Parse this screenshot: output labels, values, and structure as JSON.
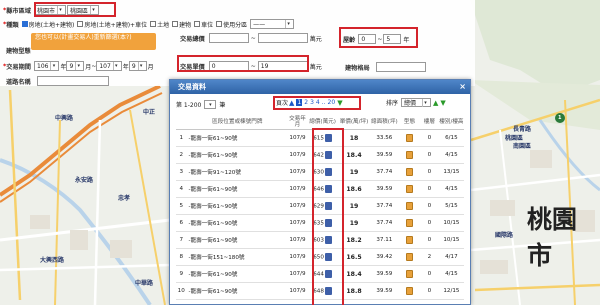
{
  "form": {
    "row1": {
      "label": "縣市區域",
      "city": "桃園市",
      "district": "桃園區"
    },
    "row2": {
      "label": "種類",
      "options": [
        "房地(土地+建物)",
        "房地(土地+建物)+車位",
        "土地",
        "建物",
        "車位",
        "使用分區"
      ],
      "zone_placeholder": "——"
    },
    "row3": {
      "label": "交易總價",
      "unit": "萬元",
      "age_label": "屋齡",
      "age_from": "0",
      "age_to": "5",
      "age_unit": "年"
    },
    "row4": {
      "label": "建物型態"
    },
    "row5": {
      "label": "交易單價",
      "from": "0",
      "to": "19",
      "unit": "萬元",
      "area_label": "建物格局"
    },
    "row6": {
      "label": "交易期間",
      "y1": "106",
      "m1": "9",
      "y2": "107",
      "m2": "9",
      "y_lbl": "年",
      "m_lbl": "月",
      "sep": "~"
    },
    "row7": {
      "label": "道路名稱"
    },
    "orange_button": "您也可以(計畫交易人)重新篩選(本?)"
  },
  "dialog": {
    "title": "交易資料",
    "range": "第 1-200",
    "range_unit": "筆",
    "page_label": "頁次",
    "pages": [
      "1",
      "2",
      "3",
      "4",
      "..",
      "20"
    ],
    "sort_label": "排序",
    "sort_value": "總價",
    "headers": [
      "區段位置或棟號門牌",
      "交易年月",
      "總價(萬元)",
      "單價(萬/坪)",
      "總面積(坪)",
      "型態",
      "樓層",
      "樓別/樓高"
    ],
    "rows": [
      {
        "no": "1",
        "addr": "-龍壽一街61~90號",
        "date": "107/9",
        "total": "615",
        "unit": "18",
        "area": "33.56",
        "floor": "0",
        "level": "6/15"
      },
      {
        "no": "2",
        "addr": "-龍壽一街61~90號",
        "date": "107/9",
        "total": "642",
        "unit": "18.4",
        "area": "39.59",
        "floor": "0",
        "level": "4/15"
      },
      {
        "no": "3",
        "addr": "-龍壽一街91~120號",
        "date": "107/9",
        "total": "630",
        "unit": "19",
        "area": "37.74",
        "floor": "0",
        "level": "13/15"
      },
      {
        "no": "4",
        "addr": "-龍壽一街61~90號",
        "date": "107/9",
        "total": "646",
        "unit": "18.6",
        "area": "39.59",
        "floor": "0",
        "level": "4/15"
      },
      {
        "no": "5",
        "addr": "-龍壽一街61~90號",
        "date": "107/9",
        "total": "629",
        "unit": "19",
        "area": "37.74",
        "floor": "0",
        "level": "5/15"
      },
      {
        "no": "6",
        "addr": "-龍壽一街61~90號",
        "date": "107/9",
        "total": "635",
        "unit": "19",
        "area": "37.74",
        "floor": "0",
        "level": "10/15"
      },
      {
        "no": "7",
        "addr": "-龍壽一街61~90號",
        "date": "107/9",
        "total": "603",
        "unit": "18.2",
        "area": "37.11",
        "floor": "0",
        "level": "10/15"
      },
      {
        "no": "8",
        "addr": "-龍壽一街151~180號",
        "date": "107/9",
        "total": "650",
        "unit": "16.5",
        "area": "39.42",
        "floor": "2",
        "level": "4/17"
      },
      {
        "no": "9",
        "addr": "-龍壽一街61~90號",
        "date": "107/9",
        "total": "644",
        "unit": "18.4",
        "area": "39.59",
        "floor": "0",
        "level": "4/15"
      },
      {
        "no": "10",
        "addr": "-龍壽一街61~90號",
        "date": "107/9",
        "total": "648",
        "unit": "18.8",
        "area": "39.59",
        "floor": "0",
        "level": "12/15"
      }
    ]
  },
  "map": {
    "city_label": "桃園市",
    "place_labels": [
      "中興路",
      "中正",
      "桃園區",
      "長青路",
      "南園區",
      "忠孝",
      "中華路",
      "大興西路",
      "永安路",
      "國際路"
    ],
    "road_number": "1"
  },
  "colors": {
    "accent": "#d4242c",
    "title_bar": "#2f63a6",
    "button_orange": "#f1a23c"
  }
}
